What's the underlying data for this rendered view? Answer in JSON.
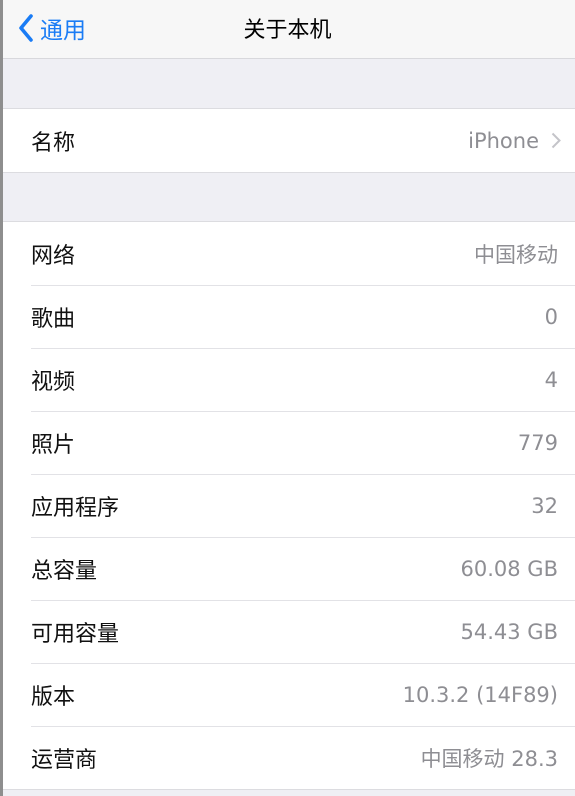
{
  "navbar": {
    "back_label": "通用",
    "title": "关于本机"
  },
  "name_row": {
    "label": "名称",
    "value": "iPhone"
  },
  "info_rows": [
    {
      "label": "网络",
      "value": "中国移动"
    },
    {
      "label": "歌曲",
      "value": "0"
    },
    {
      "label": "视频",
      "value": "4"
    },
    {
      "label": "照片",
      "value": "779"
    },
    {
      "label": "应用程序",
      "value": "32"
    },
    {
      "label": "总容量",
      "value": "60.08 GB"
    },
    {
      "label": "可用容量",
      "value": "54.43 GB"
    },
    {
      "label": "版本",
      "value": "10.3.2 (14F89)"
    },
    {
      "label": "运营商",
      "value": "中国移动 28.3"
    }
  ],
  "colors": {
    "accent": "#1a7cf5",
    "secondary_text": "#8e8e93",
    "background": "#efeff4"
  }
}
